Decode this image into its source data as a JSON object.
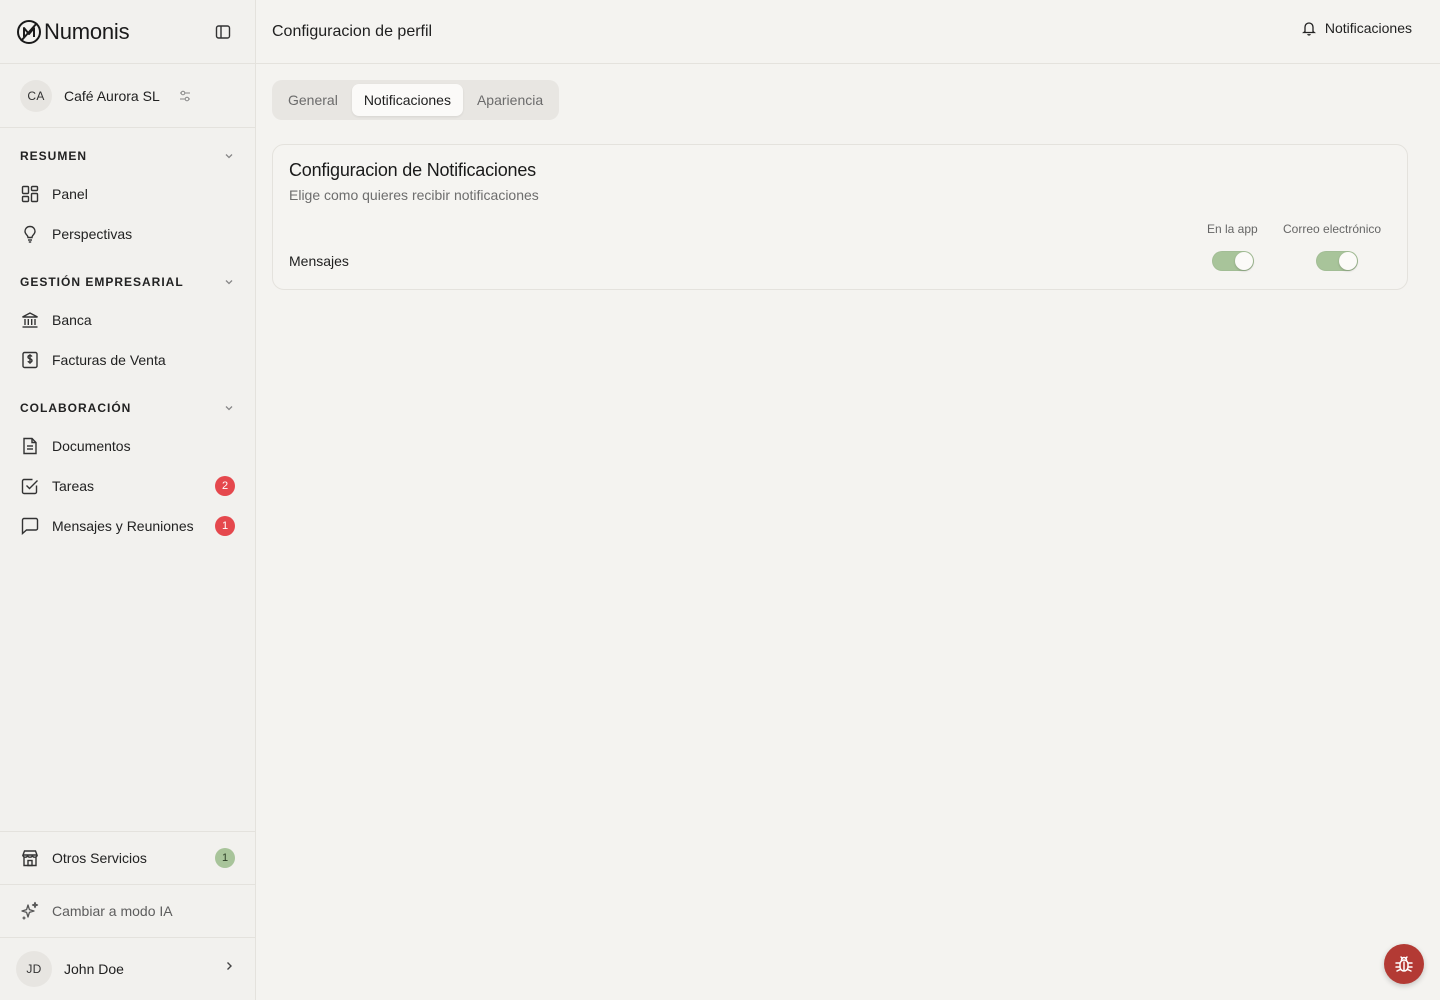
{
  "brand": {
    "name": "Numonis"
  },
  "org": {
    "initials": "CA",
    "name": "Café Aurora SL"
  },
  "sidebar": {
    "sections": [
      {
        "title": "RESUMEN",
        "items": [
          {
            "label": "Panel",
            "icon": "dashboard-icon"
          },
          {
            "label": "Perspectivas",
            "icon": "lightbulb-icon"
          }
        ]
      },
      {
        "title": "GESTIÓN EMPRESARIAL",
        "items": [
          {
            "label": "Banca",
            "icon": "bank-icon"
          },
          {
            "label": "Facturas de Venta",
            "icon": "invoice-icon"
          }
        ]
      },
      {
        "title": "COLABORACIÓN",
        "items": [
          {
            "label": "Documentos",
            "icon": "document-icon"
          },
          {
            "label": "Tareas",
            "icon": "checkbox-icon",
            "badge": "2"
          },
          {
            "label": "Mensajes y Reuniones",
            "icon": "message-icon",
            "badge": "1"
          }
        ]
      }
    ],
    "other_services": {
      "label": "Otros Servicios",
      "badge": "1",
      "icon": "store-icon"
    },
    "ai_mode": {
      "label": "Cambiar a modo IA",
      "icon": "sparkles-icon"
    },
    "user": {
      "initials": "JD",
      "name": "John Doe"
    }
  },
  "header": {
    "title": "Configuracion de perfil",
    "notifications_label": "Notificaciones"
  },
  "tabs": [
    {
      "label": "General",
      "active": false
    },
    {
      "label": "Notificaciones",
      "active": true
    },
    {
      "label": "Apariencia",
      "active": false
    }
  ],
  "card": {
    "title": "Configuracion de Notificaciones",
    "subtitle": "Elige como quieres recibir notificaciones",
    "columns": [
      "En la app",
      "Correo electrónico"
    ],
    "rows": [
      {
        "label": "Mensajes",
        "in_app": true,
        "email": true
      }
    ]
  },
  "colors": {
    "accent_toggle": "#a8c49a",
    "badge_red": "#e5484d",
    "badge_green": "#a8c49a",
    "bug_button": "#b33a34",
    "background": "#f4f3f0"
  }
}
